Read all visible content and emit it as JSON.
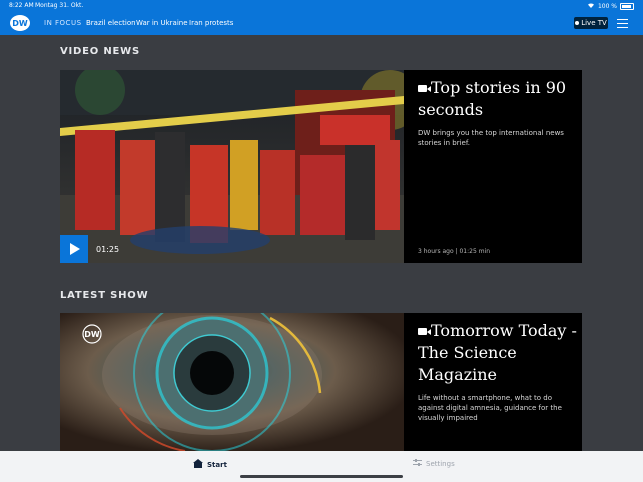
{
  "status_bar": {
    "time": "8:22 AM",
    "date": "Montag 31. Okt.",
    "battery": "100 %",
    "icons": [
      "wifi-icon",
      "battery-icon"
    ]
  },
  "header": {
    "logo_text": "DW",
    "focus_label": "IN FOCUS",
    "topics": [
      "Brazil election",
      "War in Ukraine",
      "Iran protests"
    ],
    "live_label": "Live TV",
    "menu_icon": "hamburger-menu-icon"
  },
  "video_section": {
    "title": "VIDEO NEWS",
    "headline": "Top stories in 90 seconds",
    "summary": "DW brings you the top international news stories in brief.",
    "meta": "3 hours ago  |  01:25 min",
    "duration": "01:25",
    "headline_icon": "video-camera-icon",
    "play_icon": "play-icon"
  },
  "show_section": {
    "title": "LATEST SHOW",
    "headline": "Tomorrow Today - The Science Magazine",
    "summary": "Life without a smartphone, what to do against digital amnesia, guidance for the visually impaired",
    "headline_icon": "video-camera-icon",
    "image_watermark": "DW"
  },
  "tabbar": {
    "start_label": "Start",
    "settings_label": "Settings",
    "start_icon": "home-icon",
    "settings_icon": "sliders-icon"
  },
  "colors": {
    "brand_blue": "#0a75d9",
    "background": "#3a3d42",
    "card_background": "#000000"
  }
}
